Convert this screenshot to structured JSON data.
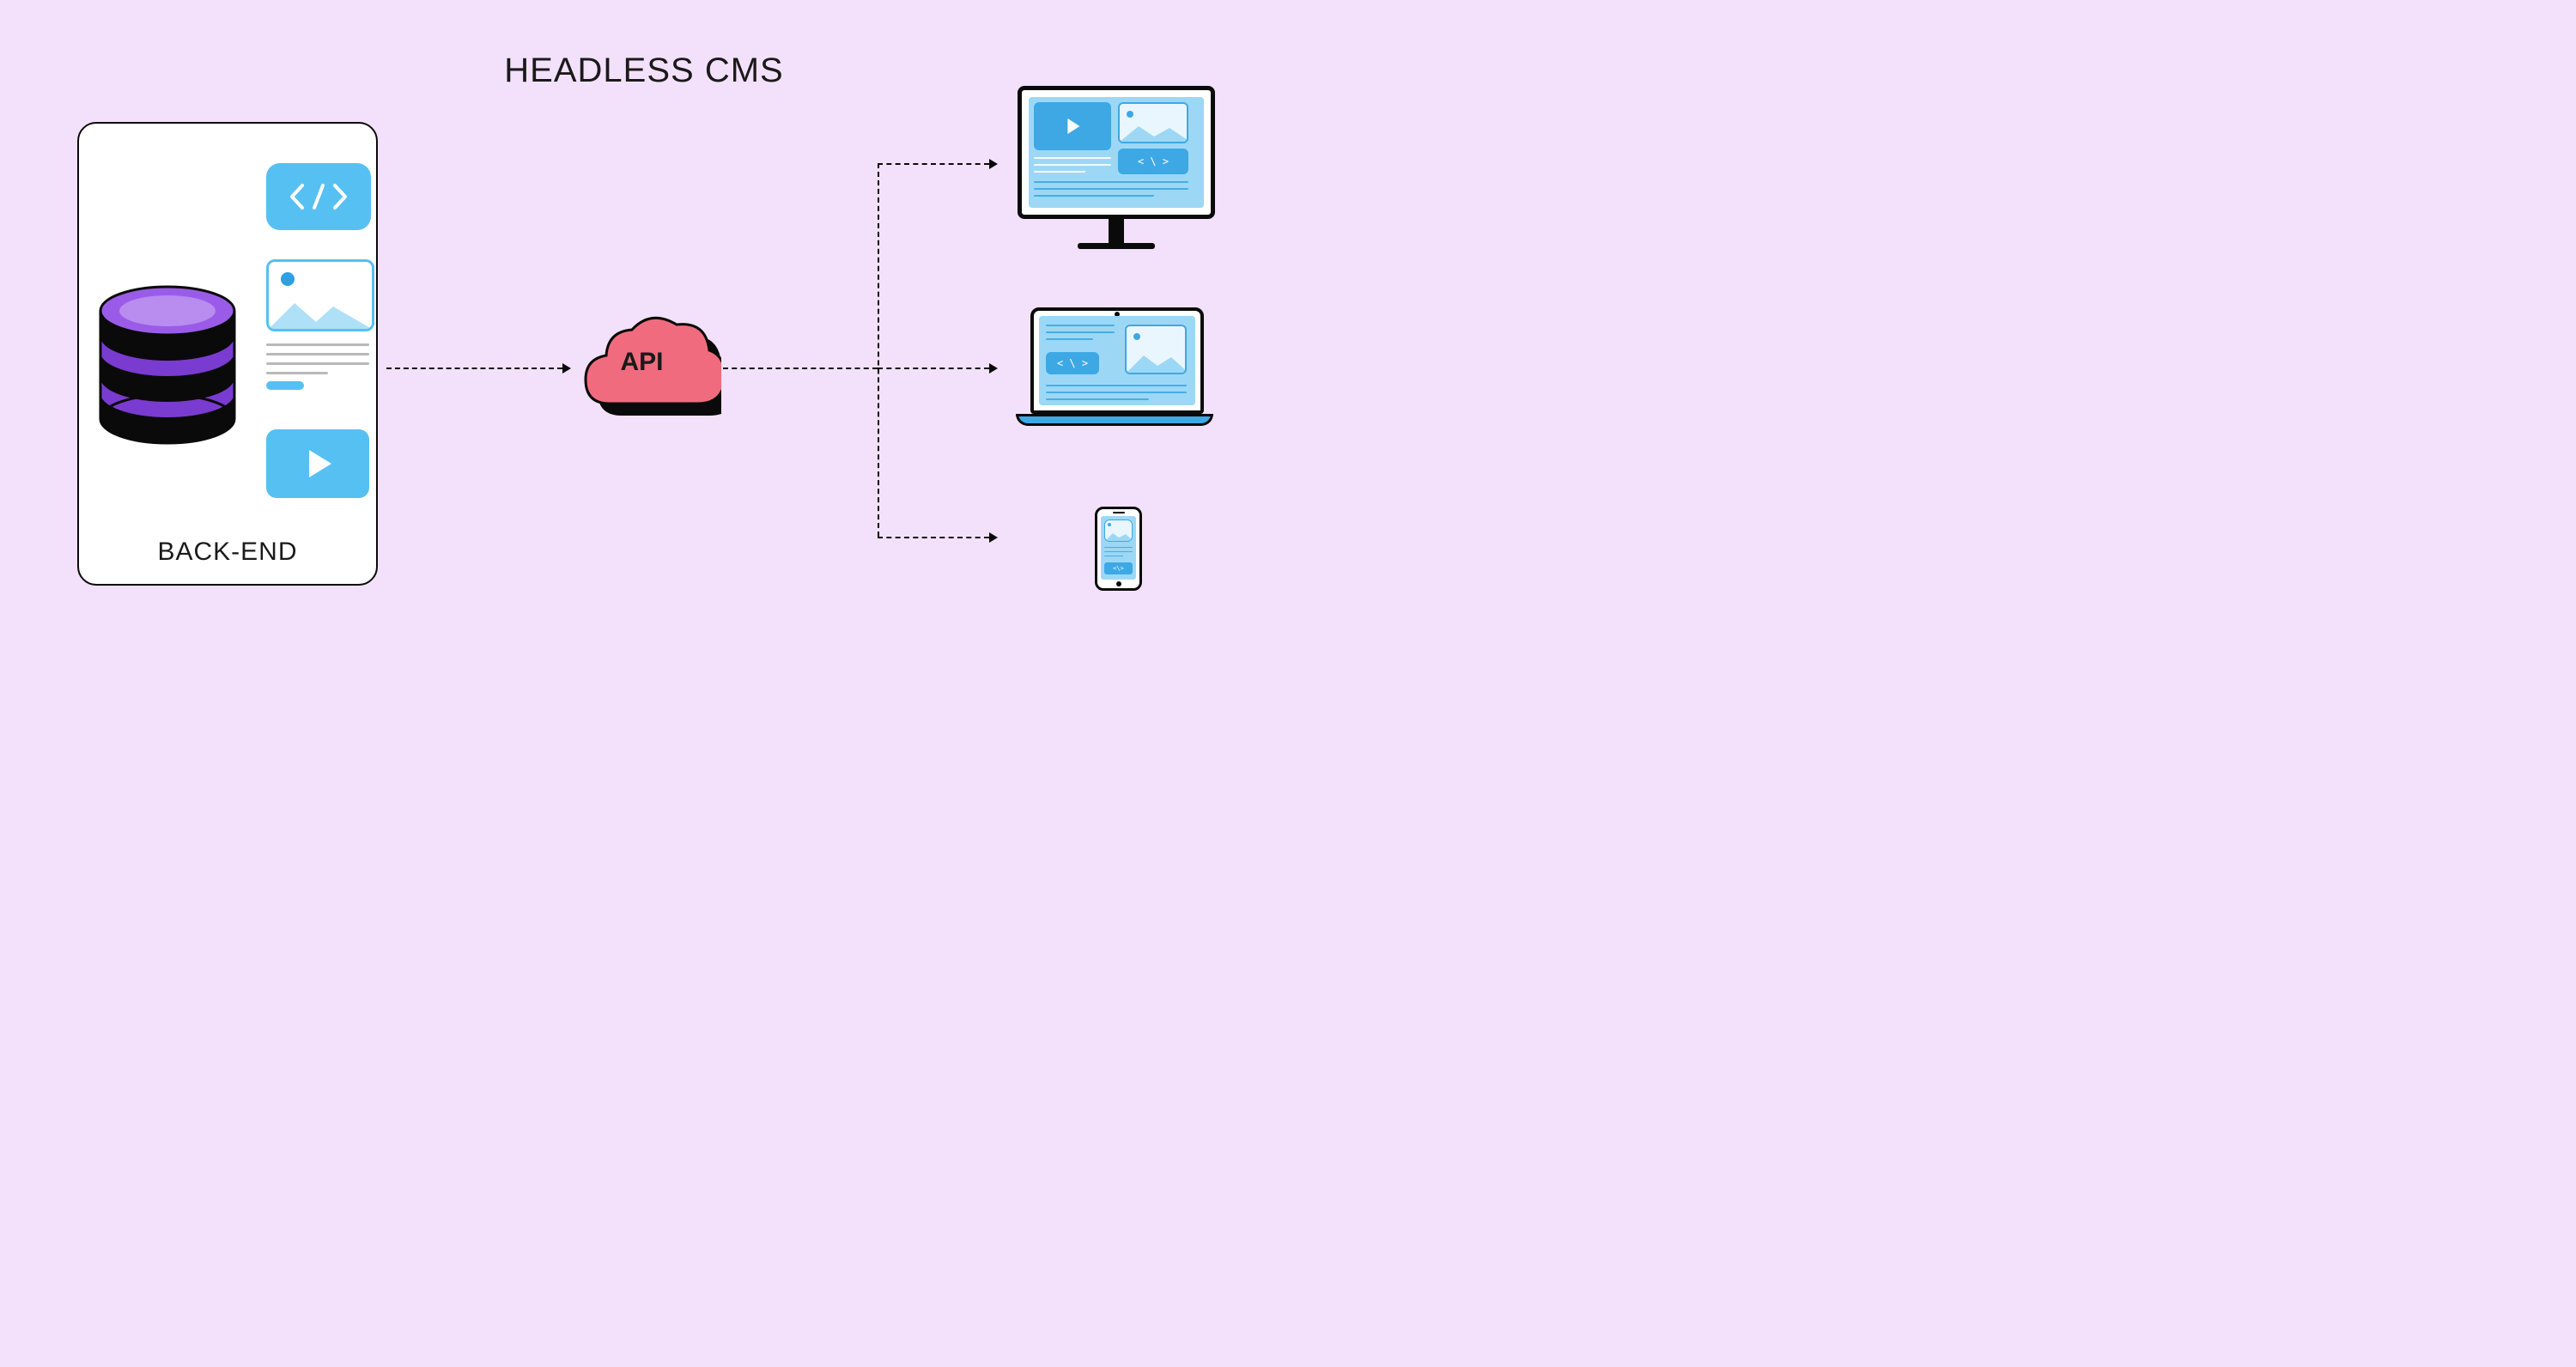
{
  "title": "HEADLESS CMS",
  "backend": {
    "label": "BACK-END",
    "content_blocks": [
      "code",
      "image",
      "text",
      "video"
    ]
  },
  "api": {
    "label": "API"
  },
  "frontends": [
    "desktop",
    "laptop",
    "mobile"
  ],
  "colors": {
    "background": "#f3e1fb",
    "accent_blue": "#56c0f2",
    "accent_purple": "#8e3fe0",
    "accent_pink": "#f16b7e",
    "black": "#0a0a0a"
  }
}
